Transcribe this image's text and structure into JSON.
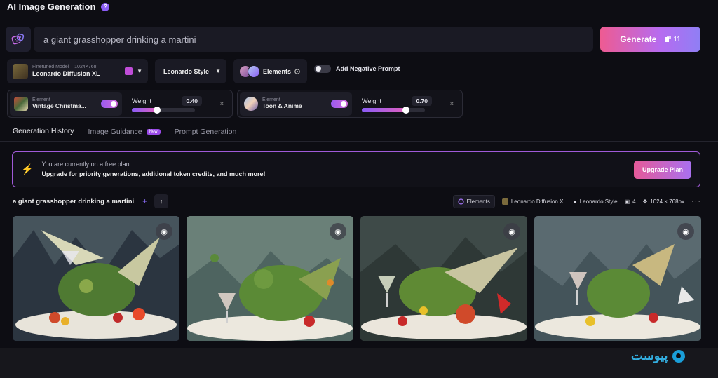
{
  "header": {
    "title": "AI Image Generation",
    "help_icon": "?"
  },
  "prompt": {
    "value": "a giant grasshopper drinking a martini",
    "generate_label": "Generate",
    "token_cost": "11"
  },
  "model": {
    "tag": "Finetuned Model",
    "resolution": "1024×768",
    "name": "Leonardo Diffusion XL"
  },
  "style": {
    "label": "Leonardo Style"
  },
  "elements_button": {
    "label": "Elements"
  },
  "negative_prompt": {
    "label": "Add Negative Prompt",
    "enabled": false
  },
  "elements": [
    {
      "tag": "Element",
      "name": "Vintage Christma...",
      "enabled": true,
      "weight_label": "Weight",
      "weight": "0.40",
      "weight_fraction": 0.4,
      "close": "×"
    },
    {
      "tag": "Element",
      "name": "Toon & Anime",
      "enabled": true,
      "weight_label": "Weight",
      "weight": "0.70",
      "weight_fraction": 0.7,
      "close": "×"
    }
  ],
  "tabs": [
    {
      "label": "Generation History",
      "active": true
    },
    {
      "label": "Image Guidance",
      "badge": "New"
    },
    {
      "label": "Prompt Generation"
    }
  ],
  "banner": {
    "line1": "You are currently on a free plan.",
    "line2": "Upgrade for priority generations, additional token credits, and much more!",
    "button": "Upgrade Plan"
  },
  "generation": {
    "prompt": "a giant grasshopper drinking a martini",
    "meta": {
      "elements": "Elements",
      "model": "Leonardo Diffusion XL",
      "style": "Leonardo Style",
      "count": "4",
      "size": "1024 × 768px"
    }
  },
  "images": [
    {
      "icon": "eye-icon"
    },
    {
      "icon": "eye-icon"
    },
    {
      "icon": "eye-icon"
    },
    {
      "icon": "eye-icon"
    }
  ],
  "watermark": {
    "text": "پیوست"
  },
  "colors": {
    "accent": "#9a5af0",
    "generate_start": "#ee5b92",
    "generate_end": "#8f7ff5",
    "banner_border": "#a05ad8"
  }
}
